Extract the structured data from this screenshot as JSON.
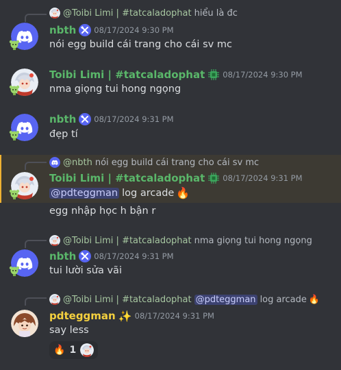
{
  "colors": {
    "background": "#313338",
    "discord_blue": "#5865f2",
    "green_name": "#5ab76a",
    "yellow_name": "#f4d03f",
    "mention_bg": "#3c4270",
    "highlight_border": "#f0b232"
  },
  "messages": [
    {
      "reply": {
        "author": "@Toibi Limi | #tatcaladophat",
        "text": "hiểu là đc"
      },
      "author": "nbth",
      "badge": "hammer-wrench-icon",
      "time": "08/17/2024 9:30 PM",
      "text": "nói egg build cái trang cho cái sv mc"
    },
    {
      "author": "Toibi Limi | #tatcaladophat",
      "badge": "chip-icon",
      "time": "08/17/2024 9:30 PM",
      "text": "nma giọng tui hong ngọng"
    },
    {
      "author": "nbth",
      "badge": "hammer-wrench-icon",
      "time": "08/17/2024 9:31 PM",
      "text": "đẹp tí"
    },
    {
      "reply": {
        "author": "@nbth",
        "text": "nói egg build cái trang cho cái sv mc"
      },
      "author": "Toibi Limi | #tatcaladophat",
      "badge": "chip-icon",
      "time": "08/17/2024 9:31 PM",
      "mention": "@pdteggman",
      "text": "log arcade",
      "emoji": "🔥",
      "text2": "egg nhập học h bận r"
    },
    {
      "reply": {
        "author": "@Toibi Limi | #tatcaladophat",
        "text": "nma giọng tui hong ngọng"
      },
      "author": "nbth",
      "badge": "hammer-wrench-icon",
      "time": "08/17/2024 9:31 PM",
      "text": "tui lười sửa vãi"
    },
    {
      "reply": {
        "author": "@Toibi Limi | #tatcaladophat",
        "mention": "@pdteggman",
        "text": "log arcade",
        "emoji": "🔥"
      },
      "author": "pdteggman",
      "badge": "sparkles-icon",
      "badge_emoji": "✨",
      "time": "08/17/2024 9:31 PM",
      "text": "say less",
      "reaction": {
        "emoji": "🔥",
        "count": "1"
      }
    }
  ]
}
